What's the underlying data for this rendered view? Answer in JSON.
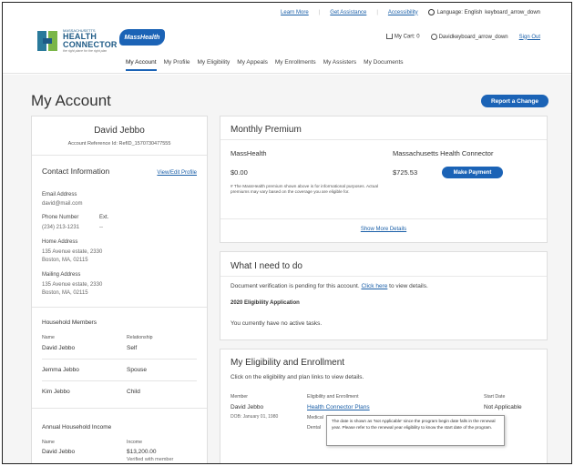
{
  "utility": {
    "learn_more": "Learn More",
    "get_assistance": "Get Assistance",
    "accessibility": "Accessibility",
    "language_label": "Language: English",
    "language_icon_text": "keyboard_arrow_down"
  },
  "header": {
    "hc_small": "MASSACHUSETTS",
    "hc_big": "HEALTH",
    "hc_big2": "CONNECTOR",
    "hc_tag": "the right place for the right plan",
    "masshealth": "MassHealth",
    "cart_label": "My Cart: 0",
    "user_name": "David",
    "user_icon_text": "keyboard_arrow_down",
    "sign_out": "Sign Out"
  },
  "nav": [
    "My Account",
    "My Profile",
    "My Eligibility",
    "My Appeals",
    "My Enrollments",
    "My Assisters",
    "My Documents"
  ],
  "page": {
    "title": "My Account",
    "report_button": "Report a Change"
  },
  "profile": {
    "name": "David Jebbo",
    "reference": "Account Reference Id: RefID_1570730477555",
    "contact_title": "Contact Information",
    "view_edit": "View/Edit Profile",
    "email_label": "Email Address",
    "email_value": "david@mail.com",
    "phone_label": "Phone Number",
    "ext_label": "Ext.",
    "phone_value": "(234) 213-1231",
    "ext_value": "--",
    "home_label": "Home Address",
    "home_line1": "135 Avenue estate, 2330",
    "home_line2": "Boston, MA, 02115",
    "mailing_label": "Mailing Address",
    "mailing_line1": "135 Avenue estate, 2330",
    "mailing_line2": "Boston, MA, 02115",
    "household_title": "Household Members",
    "col_name": "Name",
    "col_relationship": "Relationship",
    "members": [
      {
        "name": "David Jebbo",
        "relationship": "Self"
      },
      {
        "name": "Jemma Jebbo",
        "relationship": "Spouse"
      },
      {
        "name": "Kim Jebbo",
        "relationship": "Child"
      }
    ],
    "income_title": "Annual Household Income",
    "income_col_name": "Name",
    "income_col_income": "Income",
    "income_name": "David Jebbo",
    "income_value": "$13,200.00",
    "income_note": "Verified with member"
  },
  "premium": {
    "title": "Monthly Premium",
    "col1": "MassHealth",
    "col2": "Massachusetts Health Connector",
    "amount1": "$0.00",
    "amount2": "$725.53",
    "pay_button": "Make Payment",
    "fine_print": "# The MassHealth premium shown above is for informational purposes. Actual premiums may vary based on the coverage you are eligible for.",
    "show_more": "Show More Details"
  },
  "todo": {
    "title": "What I need to do",
    "msg_before": "Document verification is pending for this account. ",
    "msg_link": "Click here",
    "msg_after": " to view details.",
    "app_label": "2020 Eligibility Application",
    "none": "You currently have no active tasks."
  },
  "eligibility": {
    "title": "My Eligibility and Enrollment",
    "subtitle": "Click on the eligibility and plan links to view details.",
    "col_member": "Member",
    "col_elig": "Eligibility and Enrollment",
    "col_start": "Start Date",
    "member_name": "David Jebbo",
    "dob": "DOB: January 01, 1980",
    "plan_link": "Health Connector Plans",
    "start_value": "Not Applicable",
    "medical": "Medical",
    "dental": "Dental",
    "tooltip": "The date is shown as 'Not Applicable' since the program begin date falls in the renewal year. Please refer to the renewal year eligibility to know the start date of the program."
  }
}
